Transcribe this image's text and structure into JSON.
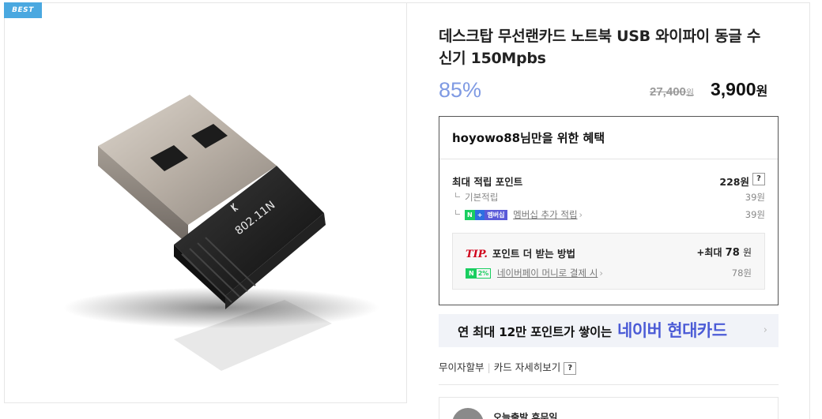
{
  "badge": {
    "label": "BEST"
  },
  "product": {
    "title": "데스크탑 무선랜카드 노트북 USB 와이파이 동글 수신기 150Mpbs",
    "image_label": "802.11N",
    "discount": "85%",
    "original_price": "27,400",
    "original_unit": "원",
    "sale_price": "3,900",
    "sale_unit": "원"
  },
  "benefit": {
    "heading": "hoyowo88님만을 위한 혜택",
    "max_points_label": "최대 적립 포인트",
    "max_points_value": "228원",
    "help": "?",
    "basic_label": "기본적립",
    "basic_value": "39원",
    "membership_badge_n": "N",
    "membership_badge_plus": "+",
    "membership_badge_text": "멤버십",
    "membership_label": "멤버십 추가 적립",
    "membership_value": "39원",
    "tip_mark": "TIP.",
    "tip_text": "포인트 더 받는 방법",
    "tip_value_prefix": "+최대",
    "tip_value_num": "78",
    "tip_value_unit": "원",
    "npay_n": "N",
    "npay_percent": "2%",
    "npay_label": "네이버페이 머니로 결제 시",
    "npay_value": "78원"
  },
  "card_banner": {
    "text1": "연 최대 12만 포인트가 쌓이는",
    "text2": "네이버 현대카드",
    "chevron": "›"
  },
  "installment": {
    "label1": "무이자할부",
    "label2": "카드 자세히보기",
    "help": "?"
  },
  "seller": {
    "name": "오늘출발 후무일"
  },
  "colors": {
    "best_badge": "#4aa8e0",
    "discount": "#7f9ae3",
    "card_highlight": "#4b5bd6",
    "npay_green": "#19ce60",
    "tip_red": "#d0021b"
  }
}
